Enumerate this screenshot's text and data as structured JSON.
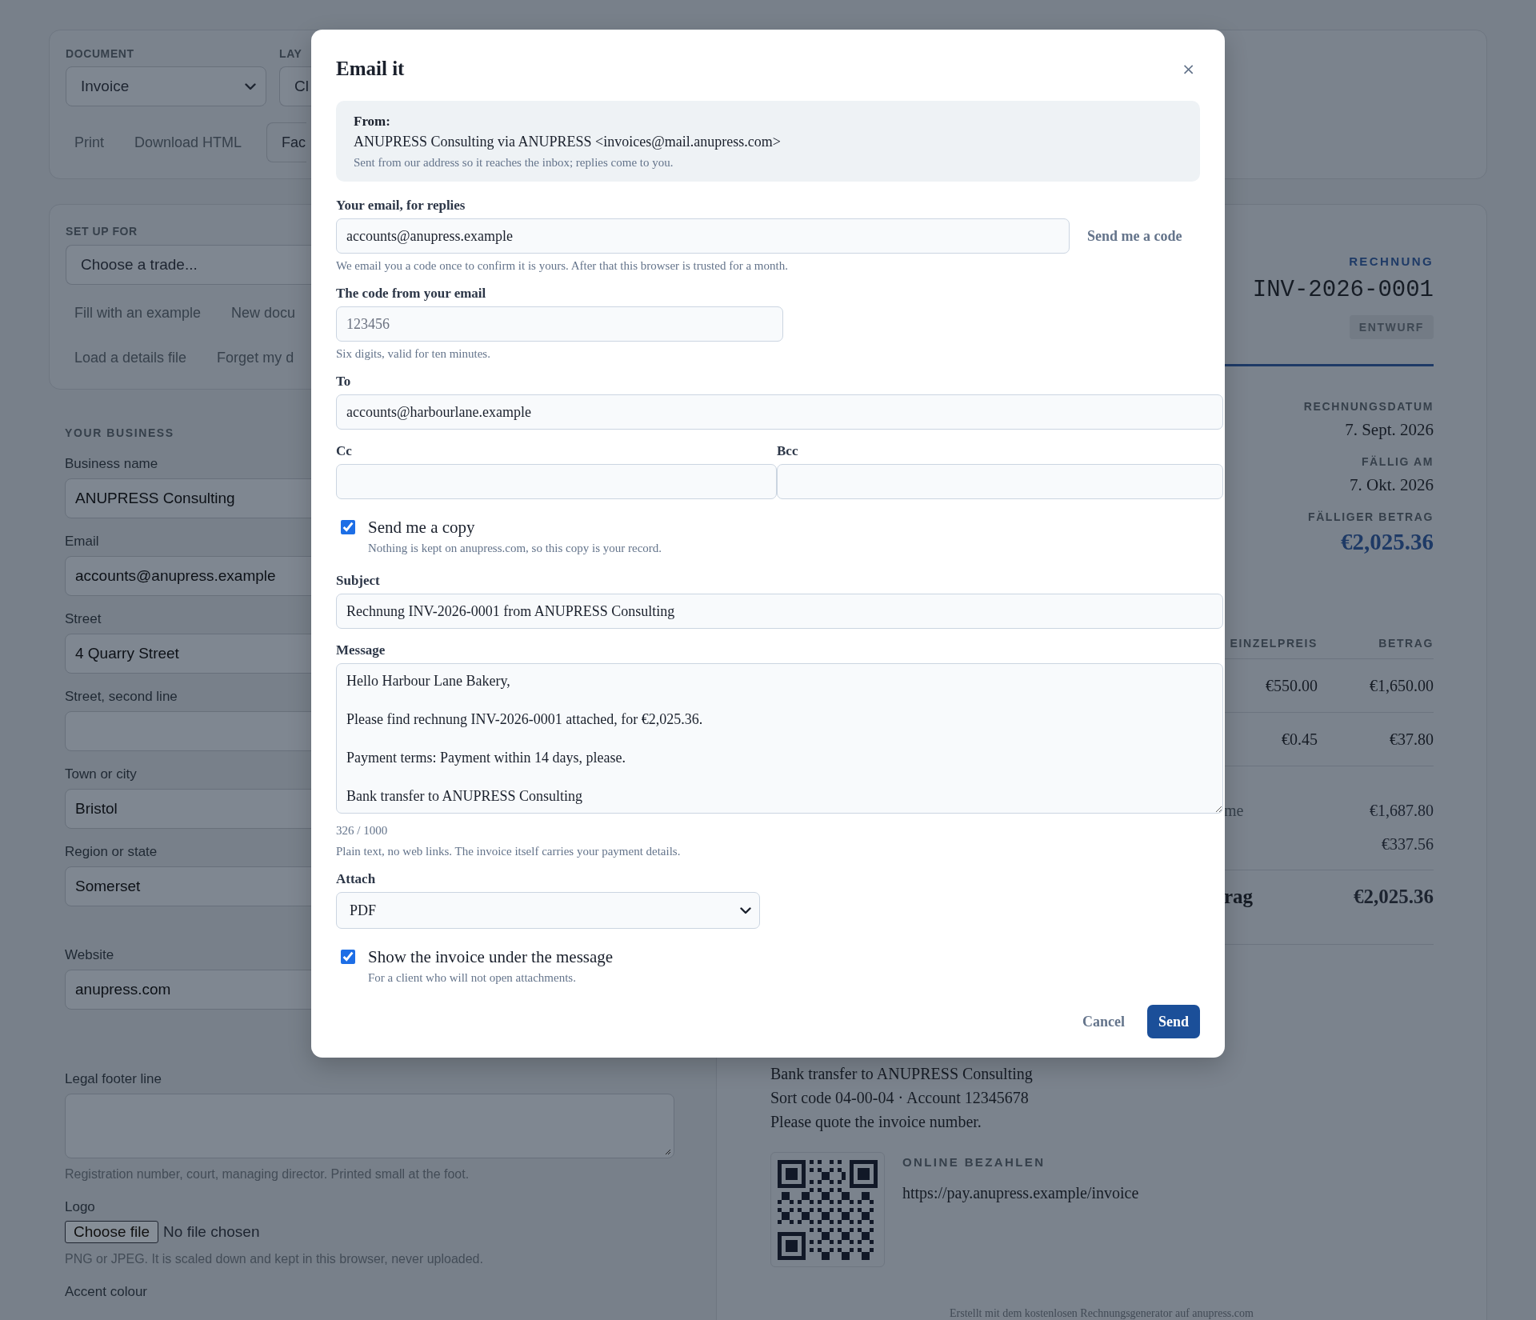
{
  "toolbar": {
    "document_label": "DOCUMENT",
    "document_value": "Invoice",
    "layout_label": "LAY",
    "layout_value": "Cl",
    "actions": [
      "Print",
      "Download HTML"
    ],
    "cut_button": "Fac"
  },
  "setup": {
    "label": "SET UP FOR",
    "trade_value": "Choose a trade...",
    "action_rows": [
      [
        "Fill with an example",
        "New docu"
      ],
      [
        "Load a details file",
        "Forget my d"
      ]
    ]
  },
  "business": {
    "heading": "YOUR BUSINESS",
    "fields": [
      {
        "label": "Business name",
        "value": "ANUPRESS Consulting"
      },
      {
        "label": "Email",
        "value": "accounts@anupress.example"
      },
      {
        "label": "Street",
        "value": "4 Quarry Street"
      },
      {
        "label": "Street, second line"
      },
      {
        "label": "Town or city",
        "value": "Bristol"
      },
      {
        "label": "Region or state",
        "value": "Somerset"
      }
    ],
    "web_fields": [
      {
        "label": "Website",
        "value": "anupress.com"
      }
    ],
    "legal_footer": {
      "label": "Legal footer line",
      "hint": "Registration number, court, managing director. Printed small at the foot."
    },
    "logo": {
      "label": "Logo",
      "button": "Choose file",
      "status": "No file chosen",
      "hint": "PNG or JPEG. It is scaled down and kept in this browser, never uploaded."
    },
    "accent": {
      "label": "Accent colour"
    }
  },
  "invoice": {
    "doc_type": "RECHNUNG",
    "number": "INV-2026-0001",
    "status": "ENTWURF",
    "meta": [
      {
        "label": "RECHNUNGSDATUM",
        "value": "7. Sept. 2026",
        "kind": "date"
      },
      {
        "label": "FÄLLIG AM",
        "value": "7. Okt. 2026",
        "kind": "date"
      },
      {
        "label": "FÄLLIGER BETRAG",
        "value": "€2,025.36",
        "kind": "amount"
      }
    ],
    "table": {
      "columns": [
        "EINZELPREIS",
        "BETRAG"
      ],
      "rows": [
        [
          "€550.00",
          "€1,650.00"
        ],
        [
          "€0.45",
          "€37.80"
        ]
      ]
    },
    "totals": [
      {
        "label": "me",
        "value": "€1,687.80",
        "kind": "line"
      },
      {
        "value": "€337.56",
        "kind": "line"
      },
      {
        "label": "rag",
        "value": "€2,025.36",
        "kind": "grand"
      }
    ],
    "payment_lines": [
      "Bank transfer to ANUPRESS Consulting",
      "Sort code 04-00-04 · Account 12345678",
      "Please quote the invoice number."
    ],
    "online": {
      "label": "ONLINE BEZAHLEN",
      "url": "https://pay.anupress.example/invoice"
    },
    "footer": "Erstellt mit dem kostenlosen Rechnungsgenerator auf anupress.com"
  },
  "modal": {
    "title": "Email it",
    "close": "×",
    "from": {
      "label": "From:",
      "value": "ANUPRESS Consulting via ANUPRESS <invoices@mail.anupress.com>",
      "hint": "Sent from our address so it reaches the inbox; replies come to you."
    },
    "reply_email": {
      "label": "Your email, for replies",
      "value": "accounts@anupress.example",
      "button": "Send me a code",
      "hint": "We email you a code once to confirm it is yours. After that this browser is trusted for a month."
    },
    "code": {
      "label": "The code from your email",
      "placeholder": "123456",
      "hint": "Six digits, valid for ten minutes."
    },
    "to": {
      "label": "To",
      "value": "accounts@harbourlane.example"
    },
    "cc": {
      "label": "Cc"
    },
    "bcc": {
      "label": "Bcc"
    },
    "send_copy": {
      "label": "Send me a copy",
      "checked": true,
      "hint": "Nothing is kept on anupress.com, so this copy is your record."
    },
    "subject": {
      "label": "Subject",
      "value": "Rechnung INV-2026-0001 from ANUPRESS Consulting"
    },
    "message": {
      "label": "Message",
      "value": "Hello Harbour Lane Bakery,\n\nPlease find rechnung INV-2026-0001 attached, for €2,025.36.\n\nPayment terms: Payment within 14 days, please.\n\nBank transfer to ANUPRESS Consulting",
      "counter": "326 / 1000",
      "hint": "Plain text, no web links. The invoice itself carries your payment details."
    },
    "attach": {
      "label": "Attach",
      "value": "PDF"
    },
    "show_invoice": {
      "label": "Show the invoice under the message",
      "checked": true,
      "hint": "For a client who will not open attachments."
    },
    "buttons": [
      {
        "label": "Cancel",
        "kind": "secondary"
      },
      {
        "label": "Send",
        "kind": "primary"
      }
    ]
  }
}
